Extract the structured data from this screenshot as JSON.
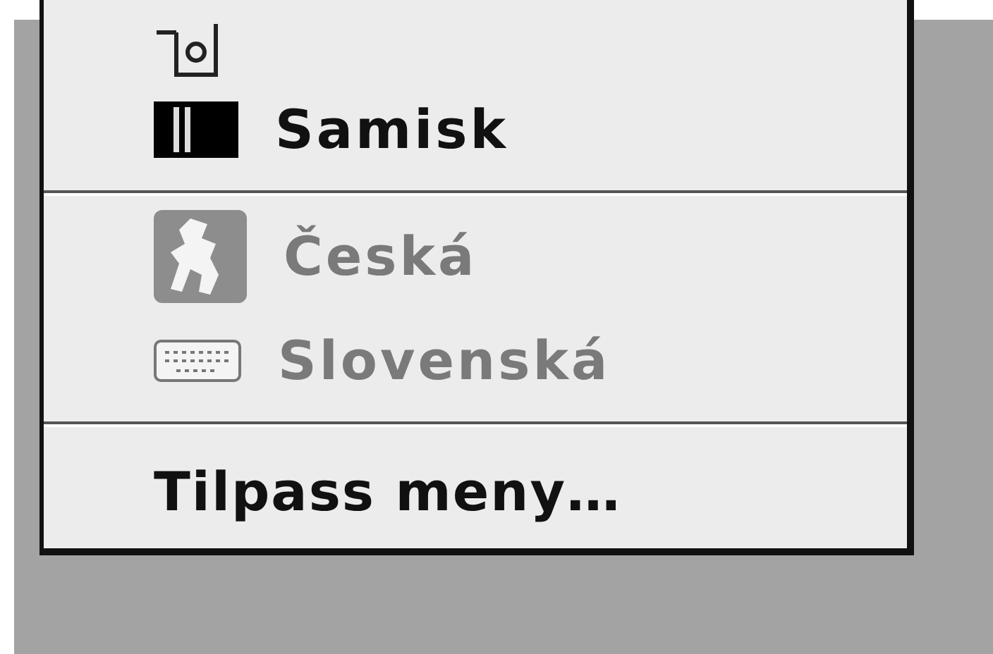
{
  "menu": {
    "items": [
      {
        "kind": "item",
        "label": "Samisk",
        "disabled": false
      },
      {
        "kind": "divider"
      },
      {
        "kind": "item",
        "label": "Česká",
        "disabled": true
      },
      {
        "kind": "item",
        "label": "Slovenská",
        "disabled": true
      },
      {
        "kind": "divider"
      },
      {
        "kind": "command",
        "label": "Tilpass meny…",
        "disabled": false
      }
    ]
  }
}
